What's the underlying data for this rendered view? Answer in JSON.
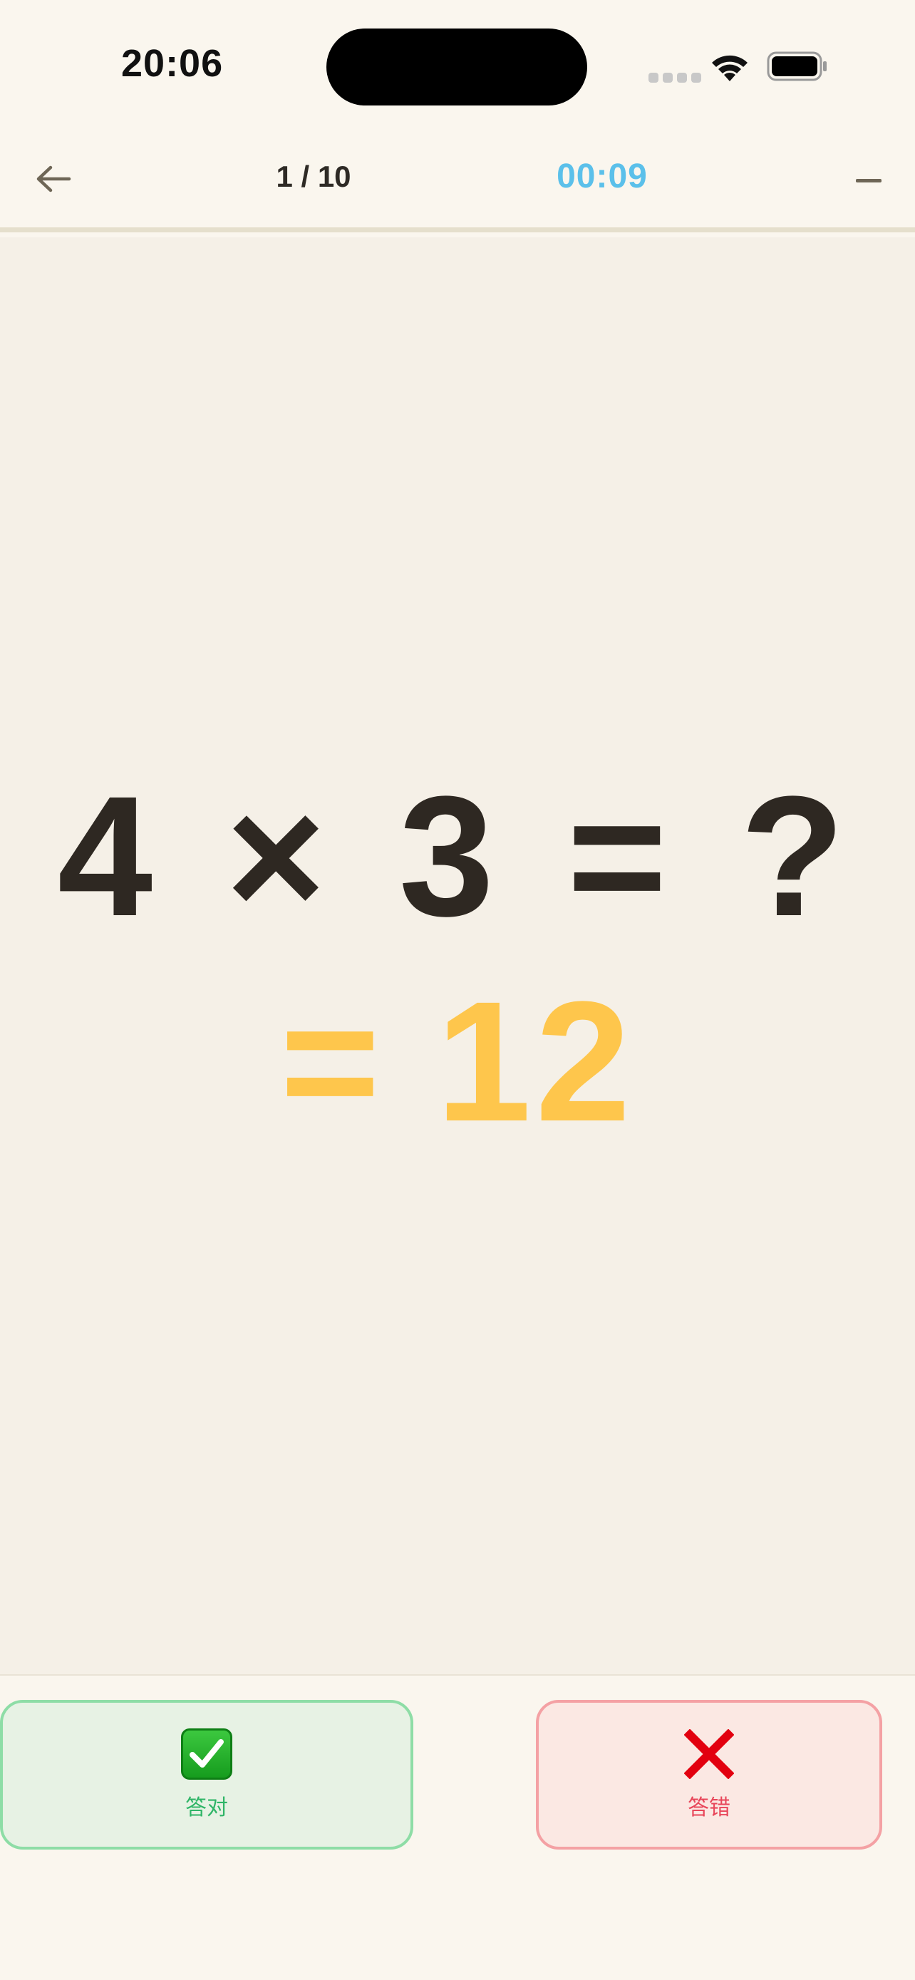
{
  "status_bar": {
    "time": "20:06"
  },
  "nav": {
    "progress": "1 / 10",
    "timer": "00:09"
  },
  "question": {
    "expression": "4 × 3 = ?",
    "answer": "= 12"
  },
  "actions": {
    "correct_label": "答对",
    "wrong_label": "答错"
  },
  "colors": {
    "background": "#FAF6EE",
    "content_background": "#F5F0E7",
    "timer": "#5BC0EA",
    "question_text": "#2E2822",
    "answer_text": "#FEC64C",
    "correct_border": "#8EDDA6",
    "wrong_border": "#F4A1A4"
  },
  "icons": {
    "back": "arrow-left-icon",
    "minus": "minus-icon",
    "correct": "check-box-icon",
    "wrong": "cross-icon"
  }
}
